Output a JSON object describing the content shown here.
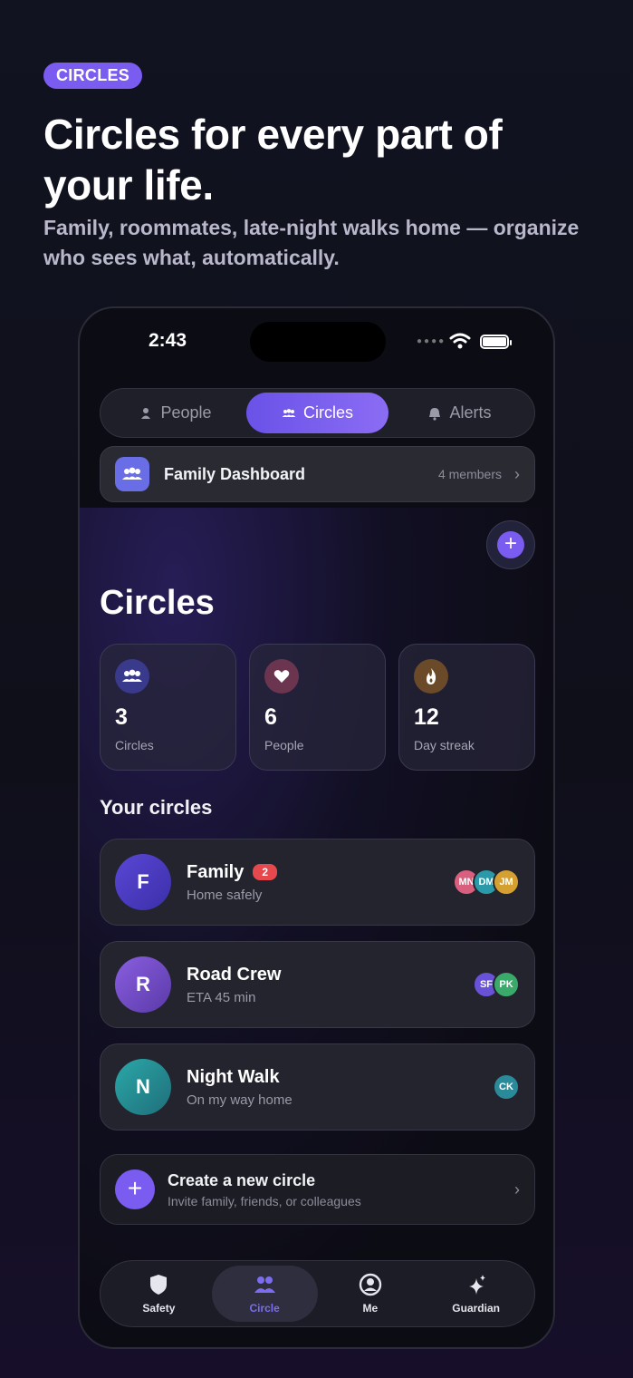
{
  "promo": {
    "pill": "CIRCLES",
    "headline": "Circles for every part of your life.",
    "subhead": "Family, roommates, late-night walks home — organize who sees what, automatically."
  },
  "status": {
    "time": "2:43"
  },
  "segments": [
    {
      "label": "People",
      "icon": "person-icon"
    },
    {
      "label": "Circles",
      "icon": "group-icon",
      "active": true
    },
    {
      "label": "Alerts",
      "icon": "bell-icon"
    }
  ],
  "dashboard": {
    "title": "Family Dashboard",
    "count": "4 members",
    "icon": "group-icon"
  },
  "page_title": "Circles",
  "stats": [
    {
      "value": "3",
      "label": "Circles",
      "icon": "group-icon",
      "color": "#3a3a8c"
    },
    {
      "value": "6",
      "label": "People",
      "icon": "heart-icon",
      "color": "#6b3550"
    },
    {
      "value": "12",
      "label": "Day streak",
      "icon": "flame-icon",
      "color": "#6b4a2a"
    }
  ],
  "section_title": "Your circles",
  "circles": [
    {
      "initial": "F",
      "name": "Family",
      "badge": "2",
      "status": "Home safely",
      "color": "#5a47d6",
      "members": [
        {
          "initials": "MN",
          "color": "#d8607e"
        },
        {
          "initials": "DM",
          "color": "#2a9aa8"
        },
        {
          "initials": "JM",
          "color": "#d6a030"
        }
      ]
    },
    {
      "initial": "R",
      "name": "Road Crew",
      "badge": "",
      "status": "ETA 45 min",
      "color": "#7b52d0",
      "members": [
        {
          "initials": "SF",
          "color": "#6a52d8"
        },
        {
          "initials": "PK",
          "color": "#3aaa6a"
        }
      ]
    },
    {
      "initial": "N",
      "name": "Night Walk",
      "badge": "",
      "status": "On my way home",
      "color": "#2a9aa0",
      "members": [
        {
          "initials": "CK",
          "color": "#2a8a9a"
        }
      ]
    }
  ],
  "create": {
    "title": "Create a new circle",
    "subtitle": "Invite family, friends, or colleagues"
  },
  "tabs": [
    {
      "label": "Safety",
      "icon": "shield-icon"
    },
    {
      "label": "Circle",
      "icon": "group-icon",
      "active": true
    },
    {
      "label": "Me",
      "icon": "profile-icon"
    },
    {
      "label": "Guardian",
      "icon": "sparkle-icon"
    }
  ],
  "colors": {
    "accent": "#7b5cf0",
    "badge": "#e5484d",
    "background": "#0c0c14"
  }
}
